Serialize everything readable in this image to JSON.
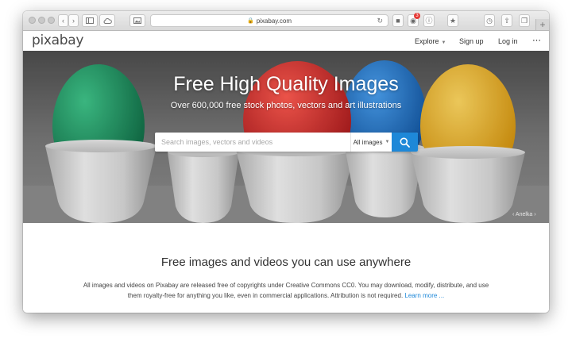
{
  "browser": {
    "url": "pixabay.com",
    "shield_badge_count": "3"
  },
  "header": {
    "logo": "pixabay",
    "nav": {
      "explore": "Explore",
      "signup": "Sign up",
      "login": "Log in",
      "more": "⋯"
    }
  },
  "hero": {
    "title": "Free High Quality Images",
    "subtitle": "Over 600,000 free stock photos, vectors and art illustrations",
    "search_placeholder": "Search images, vectors and videos",
    "type_selector": "All images",
    "photo_credit": "Anelka"
  },
  "content": {
    "title": "Free images and videos you can use anywhere",
    "text": "All images and videos on Pixabay are released free of copyrights under Creative Commons CC0. You may download, modify, distribute, and use them royalty-free for anything you like, even in commercial applications. Attribution is not required.",
    "learn_more": "Learn more ..."
  },
  "colors": {
    "accent": "#1e88d8",
    "egg_green": "#1a8c5c",
    "egg_blue": "#1a6fc4",
    "egg_red": "#d8262b",
    "egg_yellow": "#f0b418"
  }
}
